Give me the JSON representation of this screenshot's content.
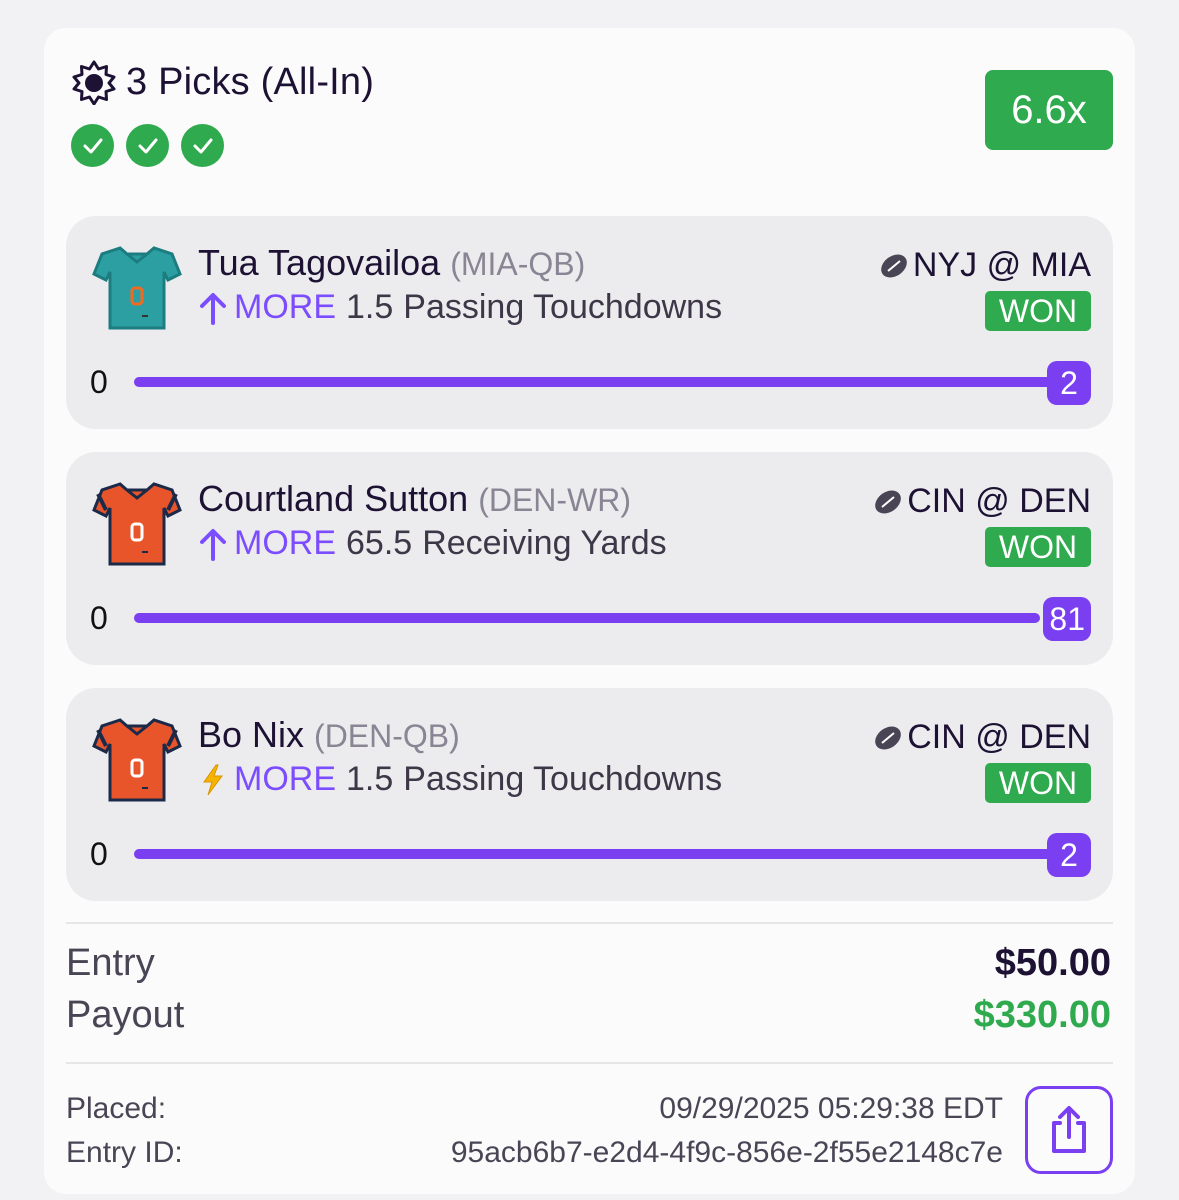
{
  "entry": {
    "title": "3 Picks (All-In)",
    "title_icon": "sun-gear-icon",
    "status_checks": 3,
    "multiplier": "6.6x"
  },
  "picks": [
    {
      "player": "Tua Tagovailoa",
      "position": "(MIA-QB)",
      "direction_icon": "arrow-up-icon",
      "direction": "MORE",
      "line": "1.5",
      "stat": "Passing Touchdowns",
      "matchup": "NYJ @ MIA",
      "result": "WON",
      "progress_start": "0",
      "progress_end": "2",
      "jersey_color": "#2c9fa3",
      "jersey_trim": "#1b7d80",
      "jersey_accent": "#f26a21"
    },
    {
      "player": "Courtland Sutton",
      "position": "(DEN-WR)",
      "direction_icon": "arrow-up-icon",
      "direction": "MORE",
      "line": "65.5",
      "stat": "Receiving Yards",
      "matchup": "CIN @ DEN",
      "result": "WON",
      "progress_start": "0",
      "progress_end": "81",
      "jersey_color": "#e8552a",
      "jersey_trim": "#1c2a4a",
      "jersey_accent": "#ffffff"
    },
    {
      "player": "Bo Nix",
      "position": "(DEN-QB)",
      "direction_icon": "lightning-icon",
      "direction": "MORE",
      "line": "1.5",
      "stat": "Passing Touchdowns",
      "matchup": "CIN @ DEN",
      "result": "WON",
      "progress_start": "0",
      "progress_end": "2",
      "jersey_color": "#e8552a",
      "jersey_trim": "#1c2a4a",
      "jersey_accent": "#ffffff"
    }
  ],
  "summary": {
    "entry_label": "Entry",
    "entry_value": "$50.00",
    "payout_label": "Payout",
    "payout_value": "$330.00"
  },
  "meta": {
    "placed_label": "Placed:",
    "placed_value": "09/29/2025 05:29:38 EDT",
    "entry_id_label": "Entry ID:",
    "entry_id_value": "95acb6b7-e2d4-4f9c-856e-2f55e2148c7e"
  },
  "colors": {
    "green": "#2faa4e",
    "purple": "#7b3ff2",
    "more_purple": "#7c4dff",
    "payout_green": "#2faa4e"
  },
  "share_icon": "share-icon"
}
